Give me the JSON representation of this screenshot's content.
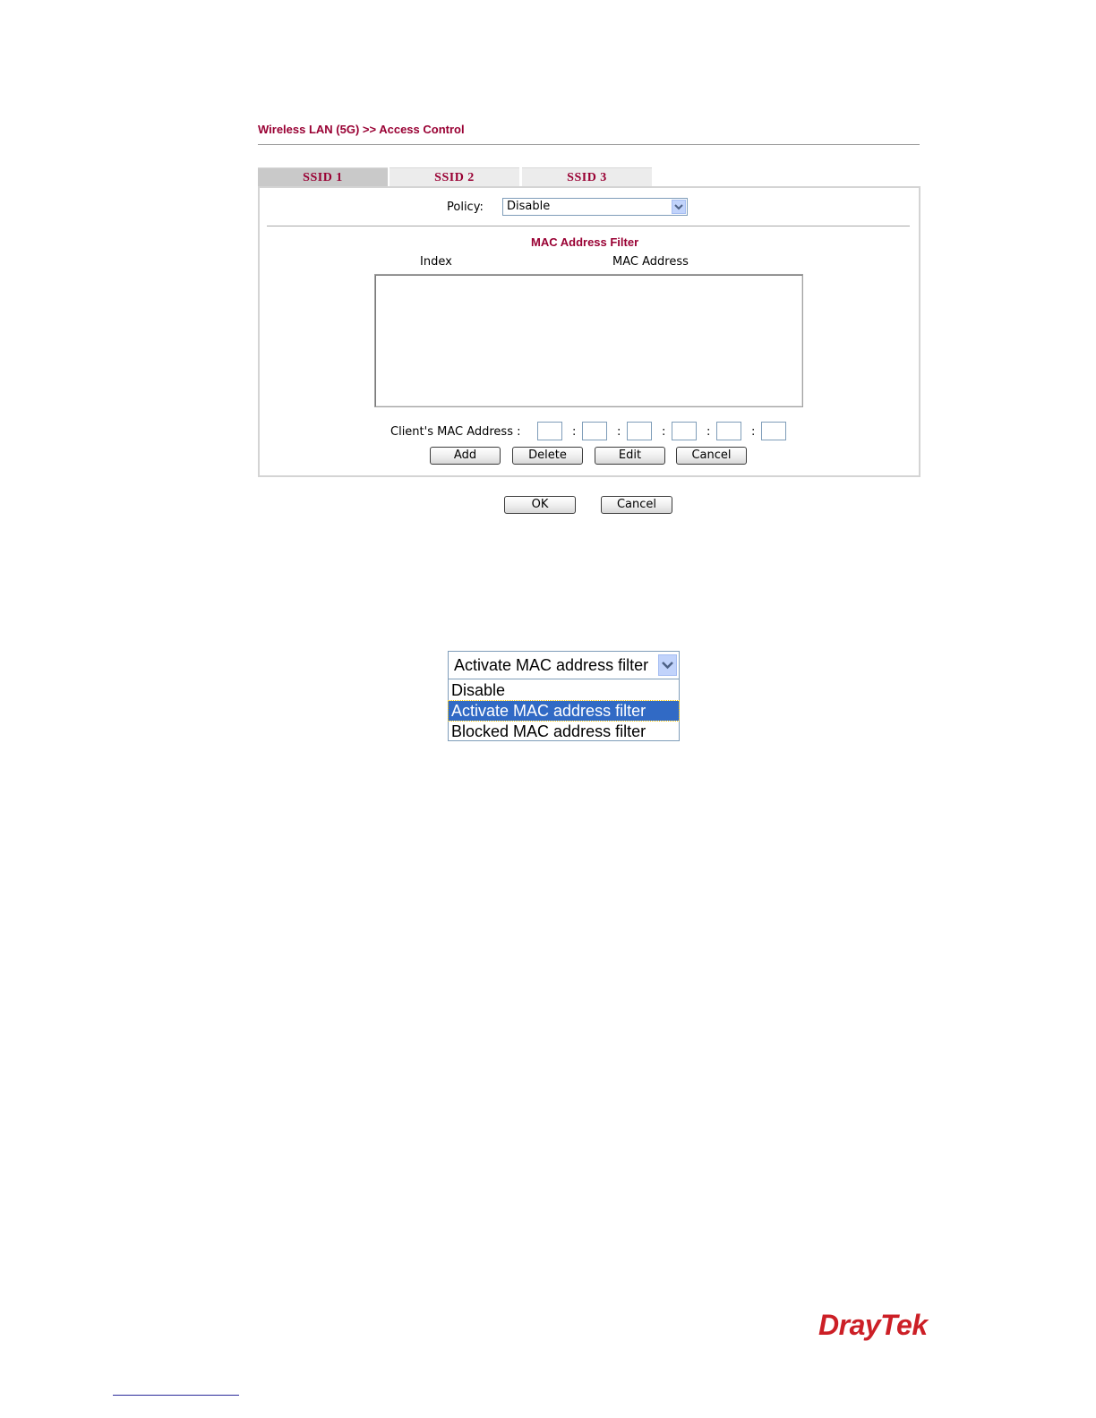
{
  "breadcrumb": "Wireless LAN (5G) >> Access Control",
  "tabs": [
    "SSID 1",
    "SSID 2",
    "SSID 3"
  ],
  "active_tab": "SSID 1",
  "policy": {
    "label": "Policy:",
    "value": "Disable"
  },
  "filter": {
    "title": "MAC Address Filter",
    "columns": [
      "Index",
      "MAC Address"
    ],
    "rows": []
  },
  "client_mac": {
    "label": "Client's MAC Address :",
    "separator": ":",
    "octets": [
      "",
      "",
      "",
      "",
      "",
      ""
    ]
  },
  "buttons": {
    "add": "Add",
    "delete": "Delete",
    "edit": "Edit",
    "cancel": "Cancel",
    "ok": "OK",
    "cancel_main": "Cancel"
  },
  "policy_dropdown": {
    "selected": "Activate MAC address filter",
    "options": [
      "Disable",
      "Activate MAC address filter",
      "Blocked MAC address filter"
    ]
  },
  "logo_text": "DrayTek",
  "colors": {
    "title": "#990033",
    "selected_option": "#316ac5",
    "logo": "#cc1f26"
  }
}
